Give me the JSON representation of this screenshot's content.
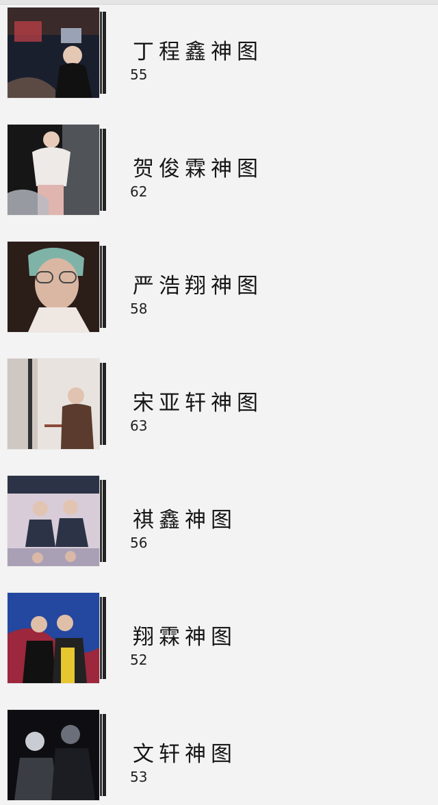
{
  "albums": [
    {
      "title": "丁程鑫神图",
      "count": "55",
      "icon": "photo-album-cover",
      "tones": [
        "#1a1f2e",
        "#c8424a",
        "#3b2a2a"
      ]
    },
    {
      "title": "贺俊霖神图",
      "count": "62",
      "icon": "photo-album-cover",
      "tones": [
        "#161616",
        "#e9d8d0",
        "#8a8f98"
      ]
    },
    {
      "title": "严浩翔神图",
      "count": "58",
      "icon": "photo-album-cover",
      "tones": [
        "#2b1d18",
        "#d9b7a3",
        "#7fb3a8"
      ]
    },
    {
      "title": "宋亚轩神图",
      "count": "63",
      "icon": "photo-album-cover",
      "tones": [
        "#cfc7c2",
        "#5a3b2e",
        "#e8e3de"
      ]
    },
    {
      "title": "祺鑫神图",
      "count": "56",
      "icon": "photo-album-cover",
      "tones": [
        "#2c3346",
        "#d8ccd8",
        "#a9a0b6"
      ]
    },
    {
      "title": "翔霖神图",
      "count": "52",
      "icon": "photo-album-cover",
      "tones": [
        "#2447a0",
        "#b3222a",
        "#e6c730"
      ]
    },
    {
      "title": "文轩神图",
      "count": "53",
      "icon": "photo-album-cover",
      "tones": [
        "#0e0e12",
        "#6a6f7a",
        "#c9ccd3"
      ]
    }
  ]
}
